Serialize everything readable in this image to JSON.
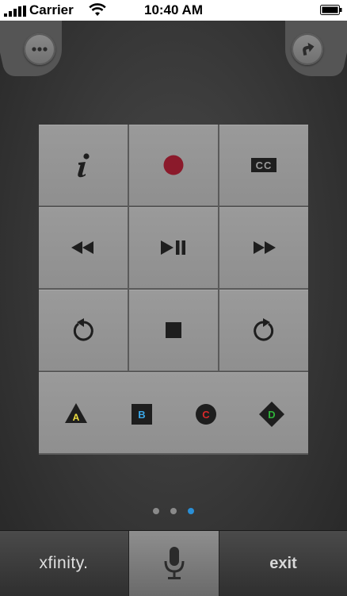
{
  "status_bar": {
    "carrier": "Carrier",
    "time": "10:40 AM"
  },
  "top_buttons": {
    "more_icon": "ellipsis-icon",
    "share_icon": "arrow-up-right-icon"
  },
  "keypad": {
    "rows": [
      [
        {
          "name": "info-button",
          "icon": "info-icon"
        },
        {
          "name": "record-button",
          "icon": "record-icon",
          "color": "#8b1a2b"
        },
        {
          "name": "closed-captions-button",
          "icon": "cc-icon",
          "label": "CC"
        }
      ],
      [
        {
          "name": "rewind-button",
          "icon": "rewind-icon"
        },
        {
          "name": "play-pause-button",
          "icon": "play-pause-icon"
        },
        {
          "name": "fast-forward-button",
          "icon": "fast-forward-icon"
        }
      ],
      [
        {
          "name": "replay-button",
          "icon": "replay-icon"
        },
        {
          "name": "stop-button",
          "icon": "stop-icon"
        },
        {
          "name": "skip-forward-button",
          "icon": "skip-forward-icon"
        }
      ]
    ],
    "color_buttons": [
      {
        "label": "A",
        "shape": "triangle",
        "color": "#f0e040"
      },
      {
        "label": "B",
        "shape": "square",
        "color": "#3aa7e8"
      },
      {
        "label": "C",
        "shape": "circle",
        "color": "#d8292a"
      },
      {
        "label": "D",
        "shape": "diamond",
        "color": "#2fb33a"
      }
    ]
  },
  "page_indicator": {
    "total": 3,
    "active": 3,
    "active_color": "#2a8fd6",
    "inactive_color": "#8a8a8a"
  },
  "bottom_bar": {
    "xfinity_label": "xfinity.",
    "mic_icon": "microphone-icon",
    "exit_label": "exit"
  }
}
